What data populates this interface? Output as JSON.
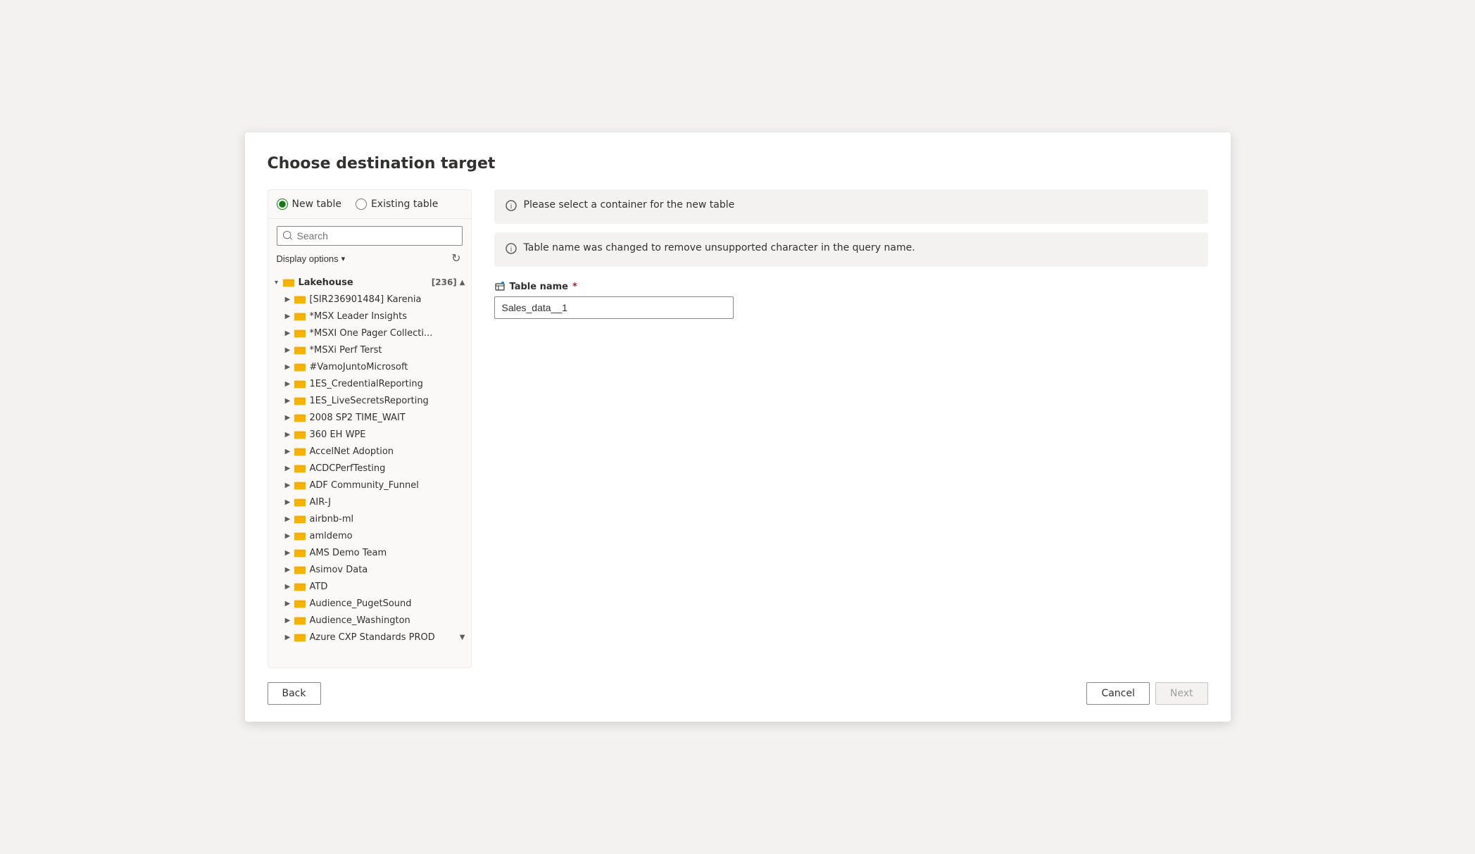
{
  "dialog": {
    "title": "Choose destination target"
  },
  "radio": {
    "new_table_label": "New table",
    "existing_table_label": "Existing table",
    "selected": "new"
  },
  "search": {
    "placeholder": "Search"
  },
  "display_options": {
    "label": "Display options"
  },
  "tree": {
    "root": {
      "label": "Lakehouse",
      "badge": "[236]"
    },
    "items": [
      {
        "label": "[SIR236901484] Karenia",
        "indent": 1
      },
      {
        "label": "*MSX Leader Insights",
        "indent": 1
      },
      {
        "label": "*MSXI One Pager Collecti...",
        "indent": 1
      },
      {
        "label": "*MSXi Perf Terst",
        "indent": 1
      },
      {
        "label": "#VamoJuntoMicrosoft",
        "indent": 1
      },
      {
        "label": "1ES_CredentialReporting",
        "indent": 1
      },
      {
        "label": "1ES_LiveSecretsReporting",
        "indent": 1
      },
      {
        "label": "2008 SP2 TIME_WAIT",
        "indent": 1
      },
      {
        "label": "360 EH WPE",
        "indent": 1
      },
      {
        "label": "AccelNet Adoption",
        "indent": 1
      },
      {
        "label": "ACDCPerfTesting",
        "indent": 1
      },
      {
        "label": "ADF Community_Funnel",
        "indent": 1
      },
      {
        "label": "AIR-J",
        "indent": 1
      },
      {
        "label": "airbnb-ml",
        "indent": 1
      },
      {
        "label": "amldemo",
        "indent": 1
      },
      {
        "label": "AMS Demo Team",
        "indent": 1
      },
      {
        "label": "Asimov Data",
        "indent": 1
      },
      {
        "label": "ATD",
        "indent": 1
      },
      {
        "label": "Audience_PugetSound",
        "indent": 1
      },
      {
        "label": "Audience_Washington",
        "indent": 1
      },
      {
        "label": "Azure CXP Standards PROD",
        "indent": 1
      }
    ]
  },
  "info_banner": {
    "text": "Please select a container for the new table"
  },
  "warning_banner": {
    "text": "Table name was changed to remove unsupported character in the query name."
  },
  "form": {
    "table_name_label": "Table name",
    "table_name_required": "*",
    "table_name_value": "Sales_data__1"
  },
  "footer": {
    "back_label": "Back",
    "cancel_label": "Cancel",
    "next_label": "Next"
  }
}
